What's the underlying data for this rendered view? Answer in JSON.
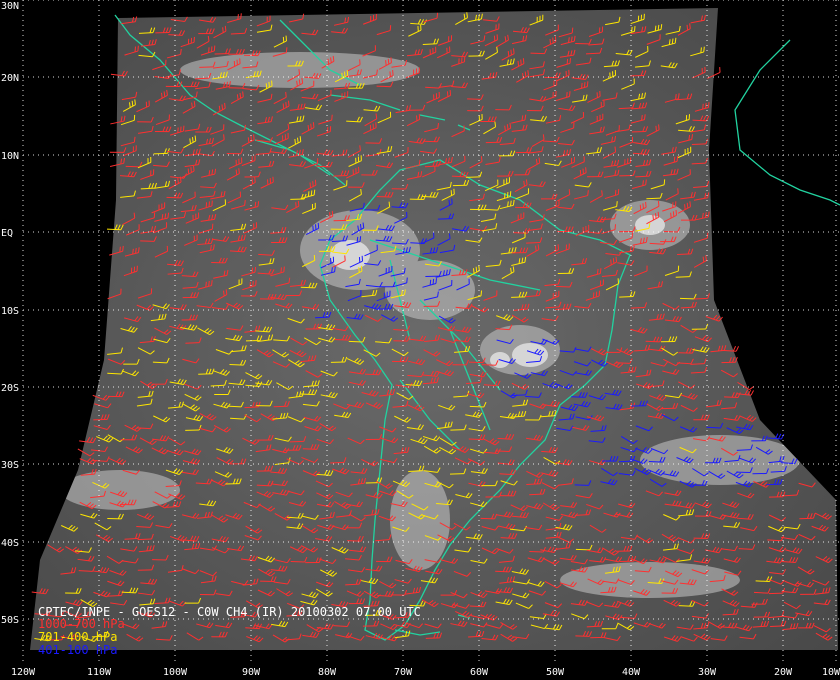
{
  "title": "CPTEC/INPE - GOES12 - C0W CH4 (IR) 20100302 07:00 UTC",
  "legend": [
    {
      "label": "1000-700 hPa",
      "color": "#ff3030"
    },
    {
      "label": "701-400 hPa",
      "color": "#ffe600"
    },
    {
      "label": "401-100 hPa",
      "color": "#1a1aff"
    }
  ],
  "lat_labels": [
    "30N",
    "20N",
    "10N",
    "EQ",
    "10S",
    "20S",
    "30S",
    "40S",
    "50S"
  ],
  "lon_labels": [
    "120W",
    "110W",
    "100W",
    "90W",
    "80W",
    "70W",
    "60W",
    "50W",
    "40W",
    "30W",
    "20W",
    "10W"
  ],
  "colors": {
    "background": "#000000",
    "coastline": "#22d3a0",
    "grid": "#ffffff",
    "image_gray": "#5a5a5a"
  }
}
